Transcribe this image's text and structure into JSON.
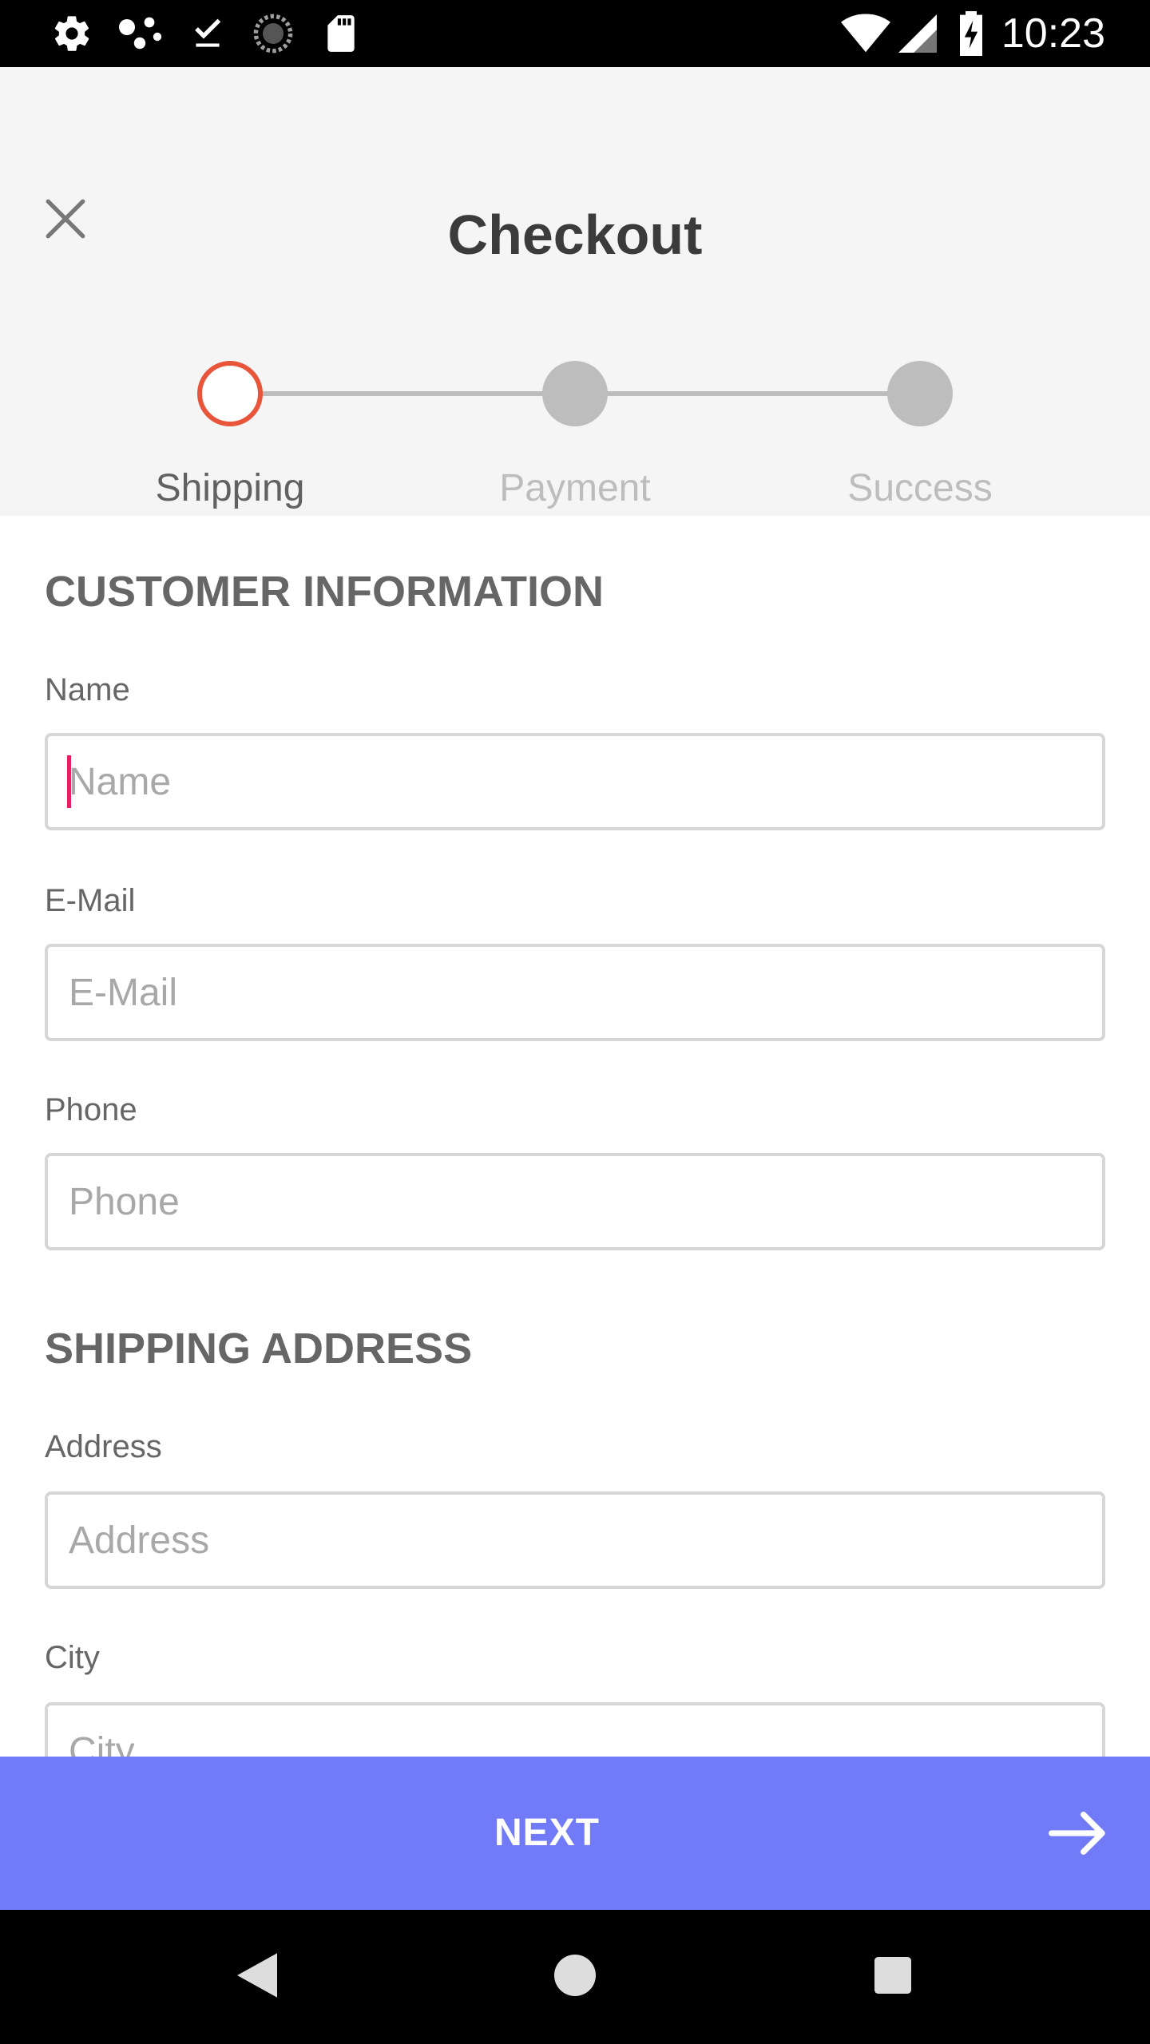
{
  "status_bar": {
    "time": "10:23",
    "icons": [
      "settings-icon",
      "dots-icon",
      "download-done-icon",
      "sync-icon",
      "sd-card-icon",
      "wifi-icon",
      "signal-icon",
      "battery-charging-icon"
    ]
  },
  "header": {
    "title": "Checkout",
    "close_icon": "close-icon"
  },
  "stepper": {
    "steps": [
      {
        "label": "Shipping",
        "active": true
      },
      {
        "label": "Payment",
        "active": false
      },
      {
        "label": "Success",
        "active": false
      }
    ],
    "active_color": "#e8553a",
    "inactive_color": "#bdbdbd"
  },
  "form": {
    "customer_section_title": "CUSTOMER INFORMATION",
    "shipping_section_title": "SHIPPING ADDRESS",
    "fields": {
      "name": {
        "label": "Name",
        "placeholder": "Name",
        "value": ""
      },
      "email": {
        "label": "E-Mail",
        "placeholder": "E-Mail",
        "value": ""
      },
      "phone": {
        "label": "Phone",
        "placeholder": "Phone",
        "value": ""
      },
      "address": {
        "label": "Address",
        "placeholder": "Address",
        "value": ""
      },
      "city": {
        "label": "City",
        "placeholder": "City",
        "value": ""
      }
    }
  },
  "next_button": {
    "label": "NEXT",
    "icon": "arrow-right-icon",
    "color": "#717bf8"
  },
  "nav_bar": {
    "icons": [
      "back-icon",
      "home-icon",
      "recents-icon"
    ]
  }
}
